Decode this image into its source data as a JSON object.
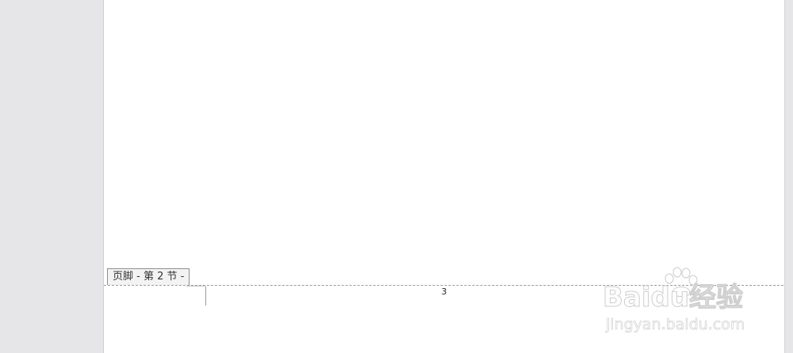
{
  "document": {
    "footer_section_label": "页脚 - 第 2 节 -",
    "page_number": "3"
  },
  "watermark": {
    "logo_text": "Baidu经验",
    "url_text": "jingyan.baidu.com"
  },
  "colors": {
    "workspace_background": "#e6e6e9",
    "page_background": "#ffffff",
    "footer_tag_background": "#f3f3f3",
    "divider": "#9a9a9a"
  }
}
